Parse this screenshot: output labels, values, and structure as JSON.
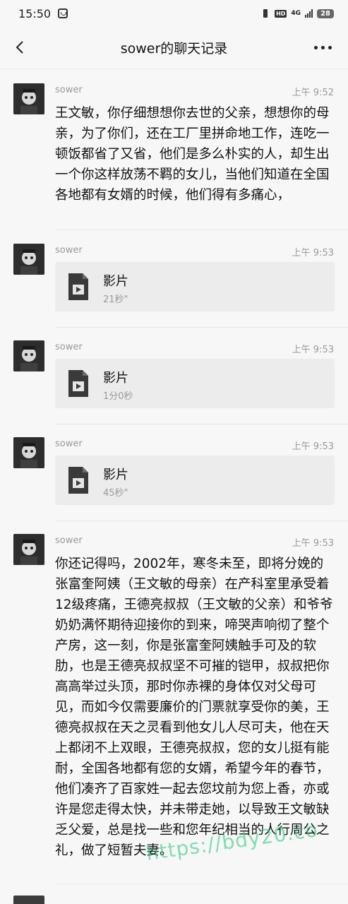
{
  "status_bar": {
    "time": "15:50",
    "hd_badge": "HD",
    "network": "4G",
    "battery": "28",
    "sim_icon": "sim-card-icon",
    "vibrate_icon": "vibrate-icon",
    "signal_icon": "signal-icon"
  },
  "header": {
    "title": "sower的聊天记录",
    "back_icon": "chevron-left-icon",
    "more_icon": "more-dots-icon"
  },
  "messages": [
    {
      "sender": "sower",
      "time": "上午 9:52",
      "type": "text",
      "text": "王文敏，你仔细想想你去世的父亲，想想你的母亲，为了你们，还在工厂里拼命地工作，连吃一顿饭都省了又省，他们是多么朴实的人，却生出一个你这样放荡不羁的女儿，当他们知道在全国各地都有女婿的时候，他们得有多痛心，"
    },
    {
      "sender": "sower",
      "time": "上午 9:53",
      "type": "video",
      "file_name": "影片",
      "duration": "21秒\""
    },
    {
      "sender": "sower",
      "time": "上午 9:53",
      "type": "video",
      "file_name": "影片",
      "duration": "1分0秒"
    },
    {
      "sender": "sower",
      "time": "上午 9:53",
      "type": "video",
      "file_name": "影片",
      "duration": "45秒\""
    },
    {
      "sender": "sower",
      "time": "上午 9:53",
      "type": "text",
      "text": "你还记得吗，2002年，寒冬未至，即将分娩的张富奎阿姨（王文敏的母亲）在产科室里承受着12级疼痛，王德亮叔叔（王文敏的父亲）和爷爷奶奶满怀期待迎接你的到来，啼哭声响彻了整个产房，这一刻，你是张富奎阿姨触手可及的软肋，也是王德亮叔叔坚不可摧的铠甲，叔叔把你高高举过头顶，那时你赤裸的身体仅对父母可见，而如今仅需要廉价的门票就享受你的美，王德亮叔叔在天之灵看到他女儿人尽可夫，他在天上都闭不上双眼，王德亮叔叔，您的女儿挺有能耐，全国各地都有您的女婿，希望今年的春节，他们凑齐了百家姓一起去您坟前为您上香，亦或许是您走得太快，并未带走她，以导致王文敏缺乏父爱，总是找一些和您年纪相当的人行周公之礼，做了短暂夫妻。"
    }
  ],
  "watermark": "https://bdy20.co"
}
